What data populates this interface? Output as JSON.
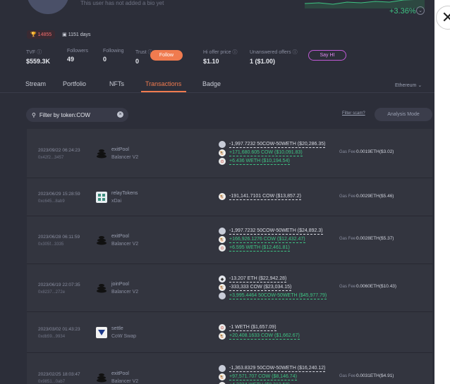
{
  "profile": {
    "bio": "This user has not added a bio yet",
    "change_pct": "+3.36%",
    "rank_badge": "14855",
    "days_badge": "1151 days",
    "stats": {
      "tvf_label": "TVF",
      "tvf_value": "$559.3K",
      "followers_label": "Followers",
      "followers_value": "49",
      "following_label": "Following",
      "following_value": "0",
      "trust_label": "Trust",
      "trust_value": "0",
      "hi_offer_label": "Hi offer price",
      "hi_offer_value": "$1.10",
      "unanswered_label": "Unanswered offers",
      "unanswered_value": "1 ($1.00)"
    },
    "follow_label": "Follow",
    "sayhi_label": "Say HI"
  },
  "tabs": [
    {
      "label": "Stream"
    },
    {
      "label": "Portfolio"
    },
    {
      "label": "NFTs"
    },
    {
      "label": "Transactions"
    },
    {
      "label": "Badge"
    }
  ],
  "network": "Ethereum",
  "filter": {
    "label": "Filter by token:COW"
  },
  "filter_scam": "Filter scam?",
  "analysis_mode": "Analysis Mode",
  "gas_label": "Gas Fee",
  "transactions": [
    {
      "date": "2023/09/22 06:24:23",
      "hash": "0x42f2...3457",
      "method": "exitPool",
      "protocol": "Balancer V2",
      "icon": "balancer",
      "gas": "0.0019ETH($3.02)",
      "tokens": [
        {
          "text": "-1,997.7232 50COW-50WETH ($20,286.35)",
          "sign": "neg",
          "icon": "eth"
        },
        {
          "text": "+171,680.605 COW ($10,091.83)",
          "sign": "pos",
          "icon": "cow"
        },
        {
          "text": "+6.436 WETH ($10,194.54)",
          "sign": "pos",
          "icon": "weth"
        }
      ]
    },
    {
      "date": "2023/06/29 15:28:59",
      "hash": "0xc645...8ab9",
      "method": "relayTokens",
      "protocol": "xDai",
      "icon": "xdai",
      "gas": "0.0029ETH($5.46)",
      "tokens": [
        {
          "text": "-191,141.7101 COW ($13,857.2)",
          "sign": "neg",
          "icon": "cow"
        }
      ]
    },
    {
      "date": "2023/06/28 06:11:59",
      "hash": "0x305f...3335",
      "method": "exitPool",
      "protocol": "Balancer V2",
      "icon": "balancer",
      "gas": "0.0028ETH($5.37)",
      "tokens": [
        {
          "text": "-1,997.7232 50COW-50WETH ($24,892.3)",
          "sign": "neg",
          "icon": "eth"
        },
        {
          "text": "+166,926.1276 COW ($12,432.47)",
          "sign": "pos",
          "icon": "cow"
        },
        {
          "text": "+6.595 WETH ($12,461.81)",
          "sign": "pos",
          "icon": "weth"
        }
      ]
    },
    {
      "date": "2023/06/19 22:07:35",
      "hash": "0x8237...272e",
      "method": "joinPool",
      "protocol": "Balancer V2",
      "icon": "balancer",
      "gas": "0.0060ETH($10.43)",
      "tokens": [
        {
          "text": "-13.207 ETH ($22,942.28)",
          "sign": "neg",
          "icon": "eth2"
        },
        {
          "text": "-333,333 COW ($23,034.15)",
          "sign": "neg",
          "icon": "cow"
        },
        {
          "text": "+3,995.4464 50COW-50WETH ($45,977.79)",
          "sign": "pos",
          "icon": "eth"
        }
      ]
    },
    {
      "date": "2023/03/02 01:43:23",
      "hash": "0xdb59...9934",
      "method": "settle",
      "protocol": "CoW Swap",
      "icon": "cowswap",
      "gas": "",
      "tokens": [
        {
          "text": "-1 WETH ($1,657.09)",
          "sign": "neg",
          "icon": "weth"
        },
        {
          "text": "+20,408.1633 COW ($1,662.67)",
          "sign": "pos",
          "icon": "cow"
        }
      ]
    },
    {
      "date": "2023/02/25 18:03:47",
      "hash": "0x9851...0ab7",
      "method": "exitPool",
      "protocol": "Balancer V2",
      "icon": "balancer",
      "gas": "0.0031ETH($4.91)",
      "tokens": [
        {
          "text": "-1,363.8329 50COW-50WETH ($16,240.12)",
          "sign": "neg",
          "icon": "eth"
        },
        {
          "text": "+97,571.707 COW ($8,146.74)",
          "sign": "pos",
          "icon": "cow"
        },
        {
          "text": "+4.2234 WETH ($8,312.58)",
          "sign": "pos",
          "icon": "weth"
        }
      ]
    }
  ]
}
